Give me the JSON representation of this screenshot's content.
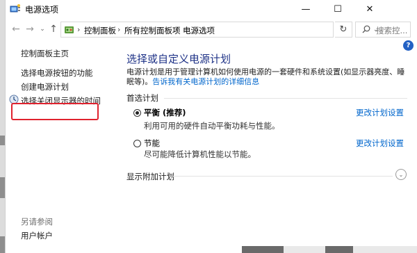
{
  "window": {
    "title": "电源选项",
    "minimize_glyph": "—",
    "maximize_glyph": "☐",
    "close_glyph": "✕"
  },
  "nav": {
    "back_glyph": "←",
    "forward_glyph": "→",
    "dropdown_glyph": "⌄",
    "up_glyph": "↑",
    "refresh_glyph": "↻"
  },
  "address": {
    "crumbs": [
      "控制面板",
      "所有控制面板项",
      "电源选项"
    ],
    "separator": "›",
    "dropdown_glyph": "⌄"
  },
  "search": {
    "placeholder": "搜索控..."
  },
  "sidebar": {
    "items": [
      {
        "label": "控制面板主页"
      },
      {
        "label": "选择电源按钮的功能"
      },
      {
        "label": "创建电源计划"
      },
      {
        "label": "选择关闭显示器的时间"
      }
    ],
    "see_also_title": "另请参阅",
    "see_also_items": [
      {
        "label": "用户帐户"
      }
    ]
  },
  "main": {
    "title": "选择或自定义电源计划",
    "description": "电源计划是用于管理计算机如何使用电源的一套硬件和系统设置(如显示器亮度、睡眠等)。",
    "description_link": "告诉我有关电源计划的详细信息",
    "preferred_label": "首选计划",
    "plans": [
      {
        "name": "平衡 (推荐)",
        "description": "利用可用的硬件自动平衡功耗与性能。",
        "selected": true,
        "change_link": "更改计划设置"
      },
      {
        "name": "节能",
        "description": "尽可能降低计算机性能以节能。",
        "selected": false,
        "change_link": "更改计划设置"
      }
    ],
    "extra_plans_label": "显示附加计划",
    "expand_glyph": "⌄"
  },
  "help": {
    "glyph": "?"
  },
  "colors": {
    "link": "#0066cc",
    "title": "#1e3287",
    "highlight": "#e0222e",
    "help": "#2361c4"
  }
}
